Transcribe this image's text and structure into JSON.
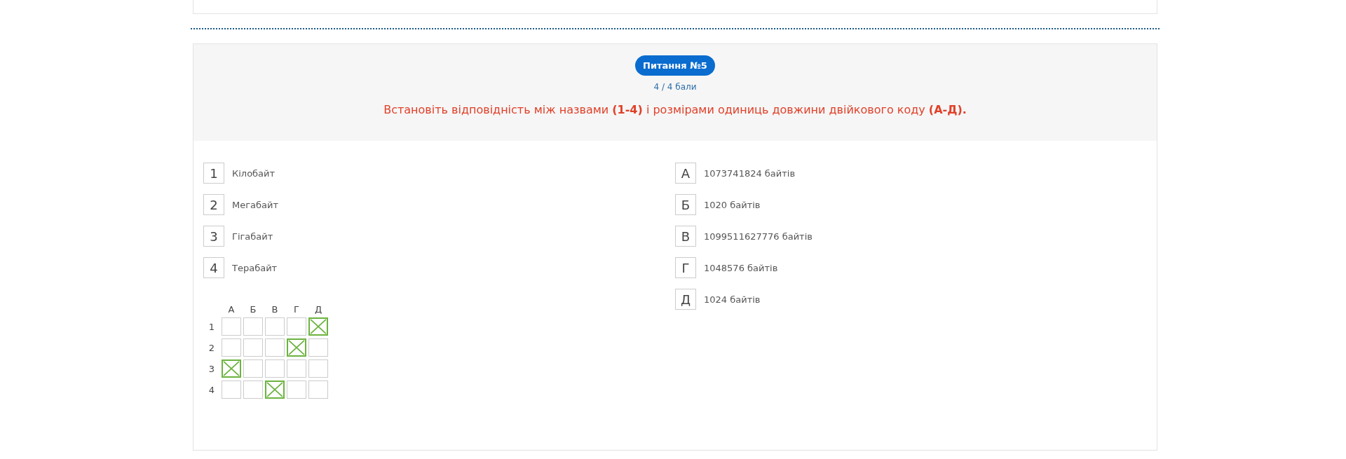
{
  "question": {
    "badge": "Питання №5",
    "score": "4 / 4 бали",
    "prompt": "Встановіть відповідність між назвами **(1-4)** і розмірами одиниць довжини двійкового коду **(А-Д).**"
  },
  "left_items": [
    {
      "key": "1",
      "text": "Кілобайт"
    },
    {
      "key": "2",
      "text": "Мегабайт"
    },
    {
      "key": "3",
      "text": "Гігабайт"
    },
    {
      "key": "4",
      "text": "Терабайт"
    }
  ],
  "right_items": [
    {
      "key": "А",
      "text": "1073741824 байтів"
    },
    {
      "key": "Б",
      "text": "1020 байтів"
    },
    {
      "key": "В",
      "text": "1099511627776 байтів"
    },
    {
      "key": "Г",
      "text": "1048576 байтів"
    },
    {
      "key": "Д",
      "text": "1024 байтів"
    }
  ],
  "answer_grid": {
    "columns": [
      "А",
      "Б",
      "В",
      "Г",
      "Д"
    ],
    "rows": [
      {
        "label": "1",
        "cells": [
          {
            "checked": false
          },
          {
            "checked": false
          },
          {
            "checked": false
          },
          {
            "checked": false
          },
          {
            "checked": true
          }
        ]
      },
      {
        "label": "2",
        "cells": [
          {
            "checked": false
          },
          {
            "checked": false
          },
          {
            "checked": false
          },
          {
            "checked": true
          },
          {
            "checked": false
          }
        ]
      },
      {
        "label": "3",
        "cells": [
          {
            "checked": true
          },
          {
            "checked": false
          },
          {
            "checked": false
          },
          {
            "checked": false
          },
          {
            "checked": false
          }
        ]
      },
      {
        "label": "4",
        "cells": [
          {
            "checked": false
          },
          {
            "checked": false
          },
          {
            "checked": true
          },
          {
            "checked": false
          },
          {
            "checked": false
          }
        ]
      }
    ]
  }
}
